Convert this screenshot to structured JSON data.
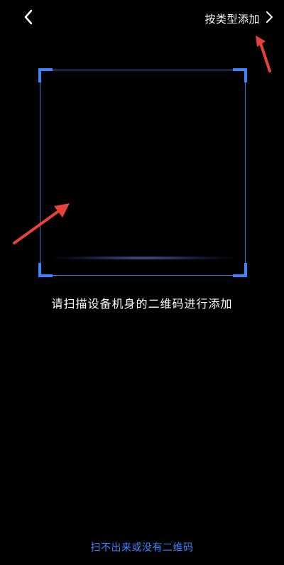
{
  "header": {
    "back_icon": "chevron-left-icon",
    "add_by_type_label": "按类型添加",
    "add_by_type_icon": "chevron-right-icon"
  },
  "scan": {
    "accent_color": "#3b86ff"
  },
  "main": {
    "hint": "请扫描设备机身的二维码进行添加"
  },
  "footer": {
    "no_qr_link": "扫不出来或没有二维码"
  },
  "annotations": {
    "arrow_color": "#e8413a"
  }
}
